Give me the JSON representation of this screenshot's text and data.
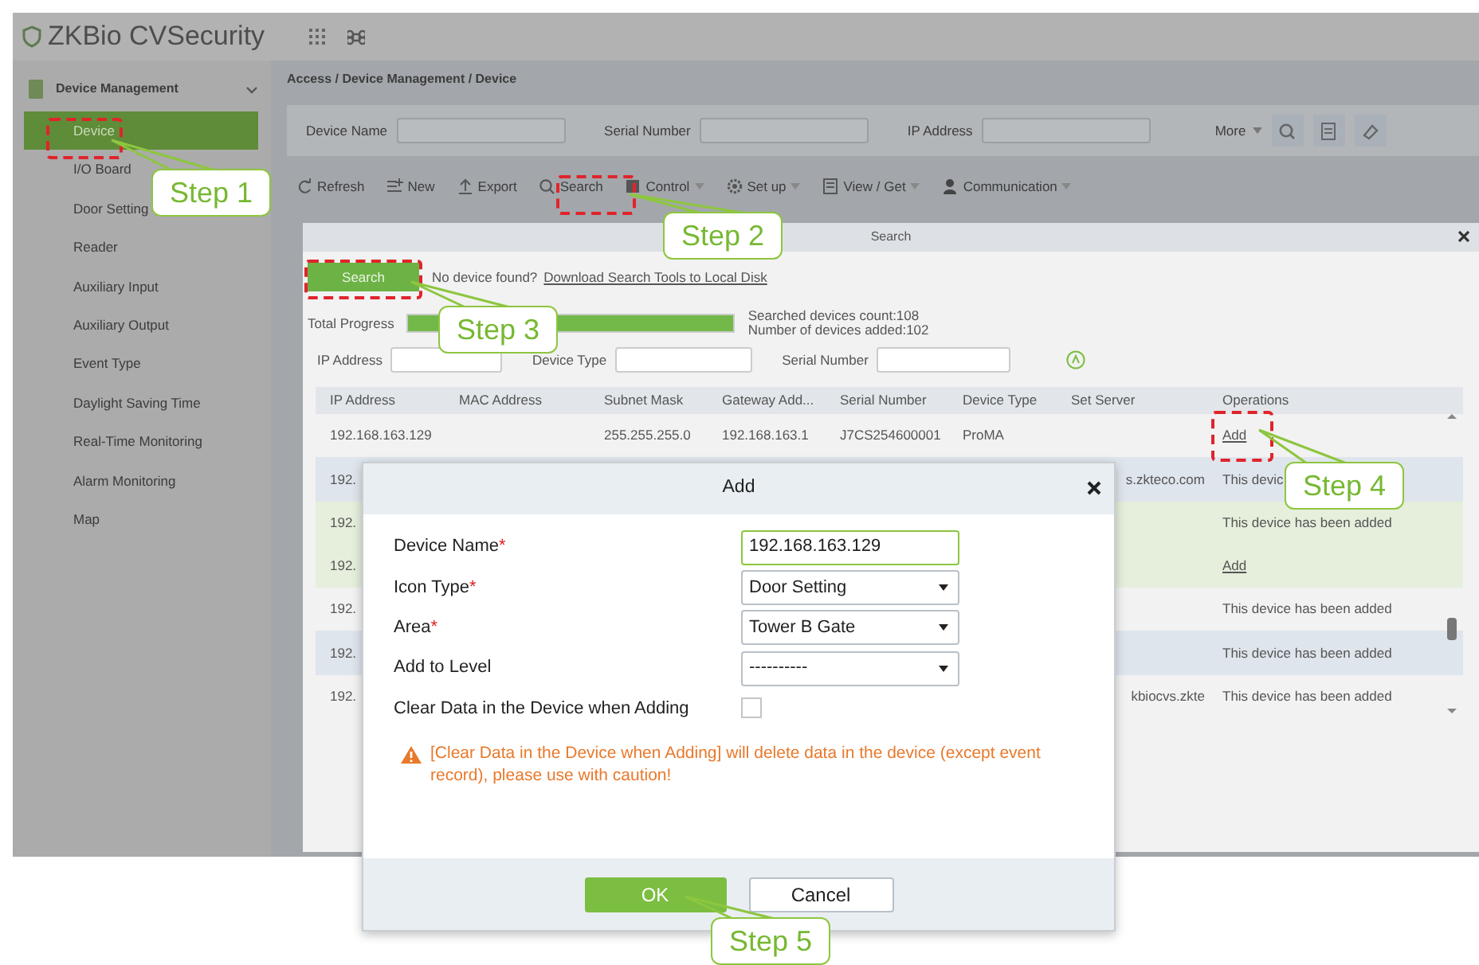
{
  "app": {
    "logo": "ZKBio CVSecurity"
  },
  "sidebar": {
    "group": "Device Management",
    "items": [
      {
        "label": "Device",
        "selected": true
      },
      {
        "label": "I/O Board",
        "selected": false
      },
      {
        "label": "Door Setting",
        "selected": false
      },
      {
        "label": "Reader",
        "selected": false
      },
      {
        "label": "Auxiliary Input",
        "selected": false
      },
      {
        "label": "Auxiliary Output",
        "selected": false
      },
      {
        "label": "Event Type",
        "selected": false
      },
      {
        "label": "Daylight Saving Time",
        "selected": false
      },
      {
        "label": "Real-Time Monitoring",
        "selected": false
      },
      {
        "label": "Alarm Monitoring",
        "selected": false
      },
      {
        "label": "Map",
        "selected": false
      }
    ]
  },
  "breadcrumb": "Access / Device Management / Device",
  "filters": [
    {
      "label": "Device Name"
    },
    {
      "label": "Serial Number"
    },
    {
      "label": "IP Address"
    }
  ],
  "more": "More",
  "toolbar": [
    {
      "label": "Refresh",
      "dropdown": false
    },
    {
      "label": "New",
      "dropdown": false
    },
    {
      "label": "Export",
      "dropdown": false
    },
    {
      "label": "Search",
      "dropdown": false
    },
    {
      "label": "Control",
      "dropdown": true
    },
    {
      "label": "Set up",
      "dropdown": true
    },
    {
      "label": "View / Get",
      "dropdown": true
    },
    {
      "label": "Communication",
      "dropdown": true
    }
  ],
  "search_dialog": {
    "title": "Search",
    "search_button": "Search",
    "hint": "No device found?",
    "link": "Download Search Tools to Local Disk",
    "progress": {
      "label": "Total Progress",
      "level": 1
    },
    "stats": [
      "Searched devices count:108",
      "Number of devices added:102"
    ],
    "filters": [
      {
        "label": "IP Address"
      },
      {
        "label": "Device Type"
      },
      {
        "label": "Serial Number"
      }
    ],
    "columns": [
      "IP Address",
      "MAC Address",
      "Subnet Mask",
      "Gateway Add...",
      "Serial Number",
      "Device Type",
      "Set Server",
      "Operations"
    ],
    "rows": [
      {
        "selected": false,
        "ip_address": "192.168.163.129",
        "subnet_mask": "255.255.255.0",
        "gateway_address": "192.168.163.1",
        "serial_number": "J7CS254600001",
        "device_type": "ProMA",
        "operation": {
          "kind": "link",
          "text": "Add"
        }
      },
      {
        "selected": false,
        "ip_address": "192.",
        "set_server": "s.zkteco.com",
        "operation": {
          "kind": "text",
          "text": "This devic"
        }
      },
      {
        "selected": true,
        "ip_address": "192.",
        "operation": {
          "kind": "text",
          "text": "This device has been added"
        }
      },
      {
        "selected": true,
        "ip_address": "192.",
        "operation": {
          "kind": "link",
          "text": "Add"
        }
      },
      {
        "selected": false,
        "ip_address": "192.",
        "operation": {
          "kind": "text",
          "text": "This device has been added"
        }
      },
      {
        "selected": false,
        "ip_address": "192.",
        "operation": {
          "kind": "text",
          "text": "This device has been added"
        }
      },
      {
        "selected": false,
        "ip_address": "192.",
        "set_server": "kbiocvs.zkte",
        "operation": {
          "kind": "text",
          "text": "This device has been added"
        }
      }
    ]
  },
  "add_dialog": {
    "title": "Add",
    "required_mark": "*",
    "fields": [
      {
        "kind": "text",
        "label": "Device Name",
        "required": true,
        "value": "192.168.163.129"
      },
      {
        "kind": "select",
        "label": "Icon Type",
        "required": true,
        "value": "Door Setting"
      },
      {
        "kind": "select",
        "label": "Area",
        "required": true,
        "value": "Tower B Gate"
      },
      {
        "kind": "select",
        "label": "Add to Level",
        "required": false,
        "value": "----------"
      },
      {
        "kind": "checkbox",
        "label": "Clear Data in the Device when Adding",
        "required": false,
        "checked": false
      }
    ],
    "warning": "[Clear Data in the Device when Adding] will delete data in the device (except event record), please use with caution!",
    "buttons": [
      {
        "label": "OK",
        "primary": true
      },
      {
        "label": "Cancel",
        "primary": false
      }
    ]
  },
  "callouts": [
    {
      "label": "Step 1"
    },
    {
      "label": "Step 2"
    },
    {
      "label": "Step 3"
    },
    {
      "label": "Step 4"
    },
    {
      "label": "Step 5"
    }
  ]
}
